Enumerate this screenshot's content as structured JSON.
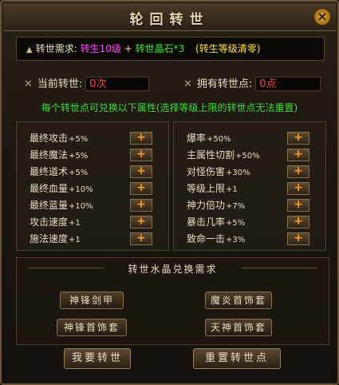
{
  "window": {
    "title": "轮回转世",
    "close_label": "×"
  },
  "requirement": {
    "label": "转世需求:",
    "level": "转生10级",
    "plus": "+",
    "crystal": "转世晶石*3",
    "note": "(转生等级清零)"
  },
  "status": {
    "current_label": "当前转世:",
    "current_value": "0次",
    "points_label": "拥有转世点:",
    "points_value": "0点"
  },
  "notice": "每个转世点可兑换以下属性(选择等级上限的转世点无法重置)",
  "left_attrs": [
    {
      "name": "最终攻击",
      "bonus": "+5%"
    },
    {
      "name": "最终魔法",
      "bonus": "+5%"
    },
    {
      "name": "最终道术",
      "bonus": "+5%"
    },
    {
      "name": "最终血量",
      "bonus": "+10%"
    },
    {
      "name": "最终蓝量",
      "bonus": "+10%"
    },
    {
      "name": "攻击速度",
      "bonus": "+1"
    },
    {
      "name": "施法速度",
      "bonus": "+1"
    }
  ],
  "right_attrs": [
    {
      "name": "爆率",
      "bonus": "+50%"
    },
    {
      "name": "主属性切割",
      "bonus": "+50%"
    },
    {
      "name": "对怪伤害",
      "bonus": "+30%"
    },
    {
      "name": "等级上限",
      "bonus": "+1"
    },
    {
      "name": "神力倍功",
      "bonus": "+7%"
    },
    {
      "name": "暴击几率",
      "bonus": "+5%"
    },
    {
      "name": "致命一击",
      "bonus": "+3%"
    }
  ],
  "plus_label": "+",
  "exchange": {
    "title": "转世水晶兑换需求",
    "items": [
      "神锋剑甲",
      "魔炎首饰套",
      "神锋首饰套",
      "天神首饰套"
    ]
  },
  "actions": {
    "reincarnate": "我要转世",
    "reset": "重置转世点"
  },
  "colors": {
    "accent_green": "#36e036",
    "value_red": "#ff4646",
    "pink": "#ff44ff",
    "yellow": "#ffe040"
  }
}
